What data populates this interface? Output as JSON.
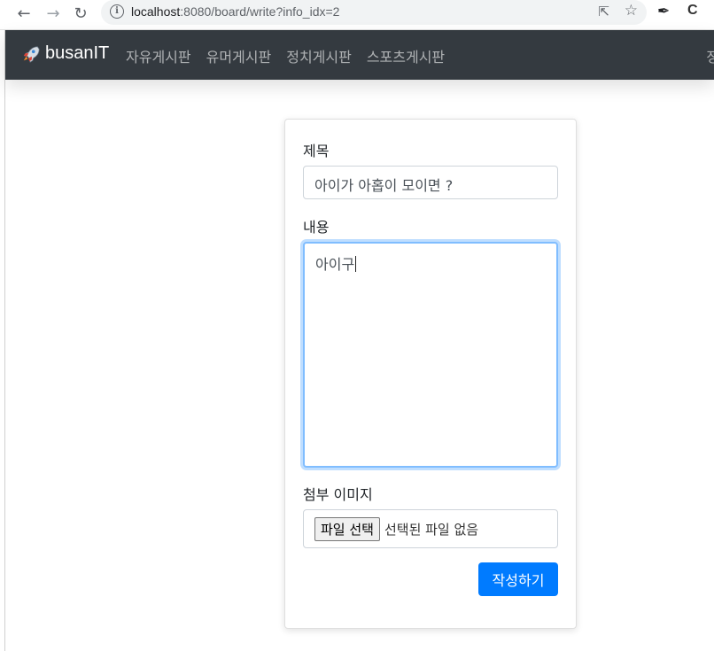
{
  "browser": {
    "url_host": "localhost",
    "url_rest": ":8080/board/write?info_idx=2"
  },
  "navbar": {
    "brand": "busanIT",
    "links": [
      "자유게시판",
      "유머게시판",
      "정치게시판",
      "스포츠게시판"
    ],
    "right_partial": "정"
  },
  "form": {
    "title_label": "제목",
    "title_value": "아이가 아홉이 모이면 ?",
    "content_label": "내용",
    "content_value": "아이구",
    "image_label": "첨부 이미지",
    "file_button": "파일 선택",
    "file_status": "선택된 파일 없음",
    "submit_label": "작성하기"
  },
  "colors": {
    "navbar_bg": "#343a40",
    "primary": "#007bff"
  }
}
